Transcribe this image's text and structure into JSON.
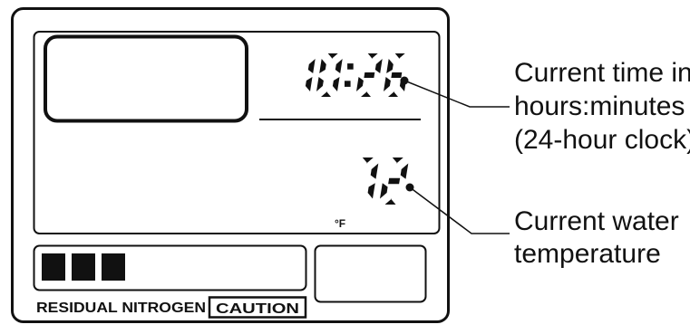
{
  "display": {
    "time": "10:26",
    "temperature": "72",
    "temperature_unit": "°F"
  },
  "nitrogen_panel": {
    "bar_count": 3,
    "label": "RESIDUAL NITROGEN",
    "caution_label": "CAUTION"
  },
  "callouts": {
    "time": [
      "Current time in",
      "hours:minutes",
      "(24-hour clock)"
    ],
    "temperature": [
      "Current water",
      "temperature"
    ]
  },
  "colors": {
    "ink": "#111111",
    "background": "#ffffff"
  }
}
